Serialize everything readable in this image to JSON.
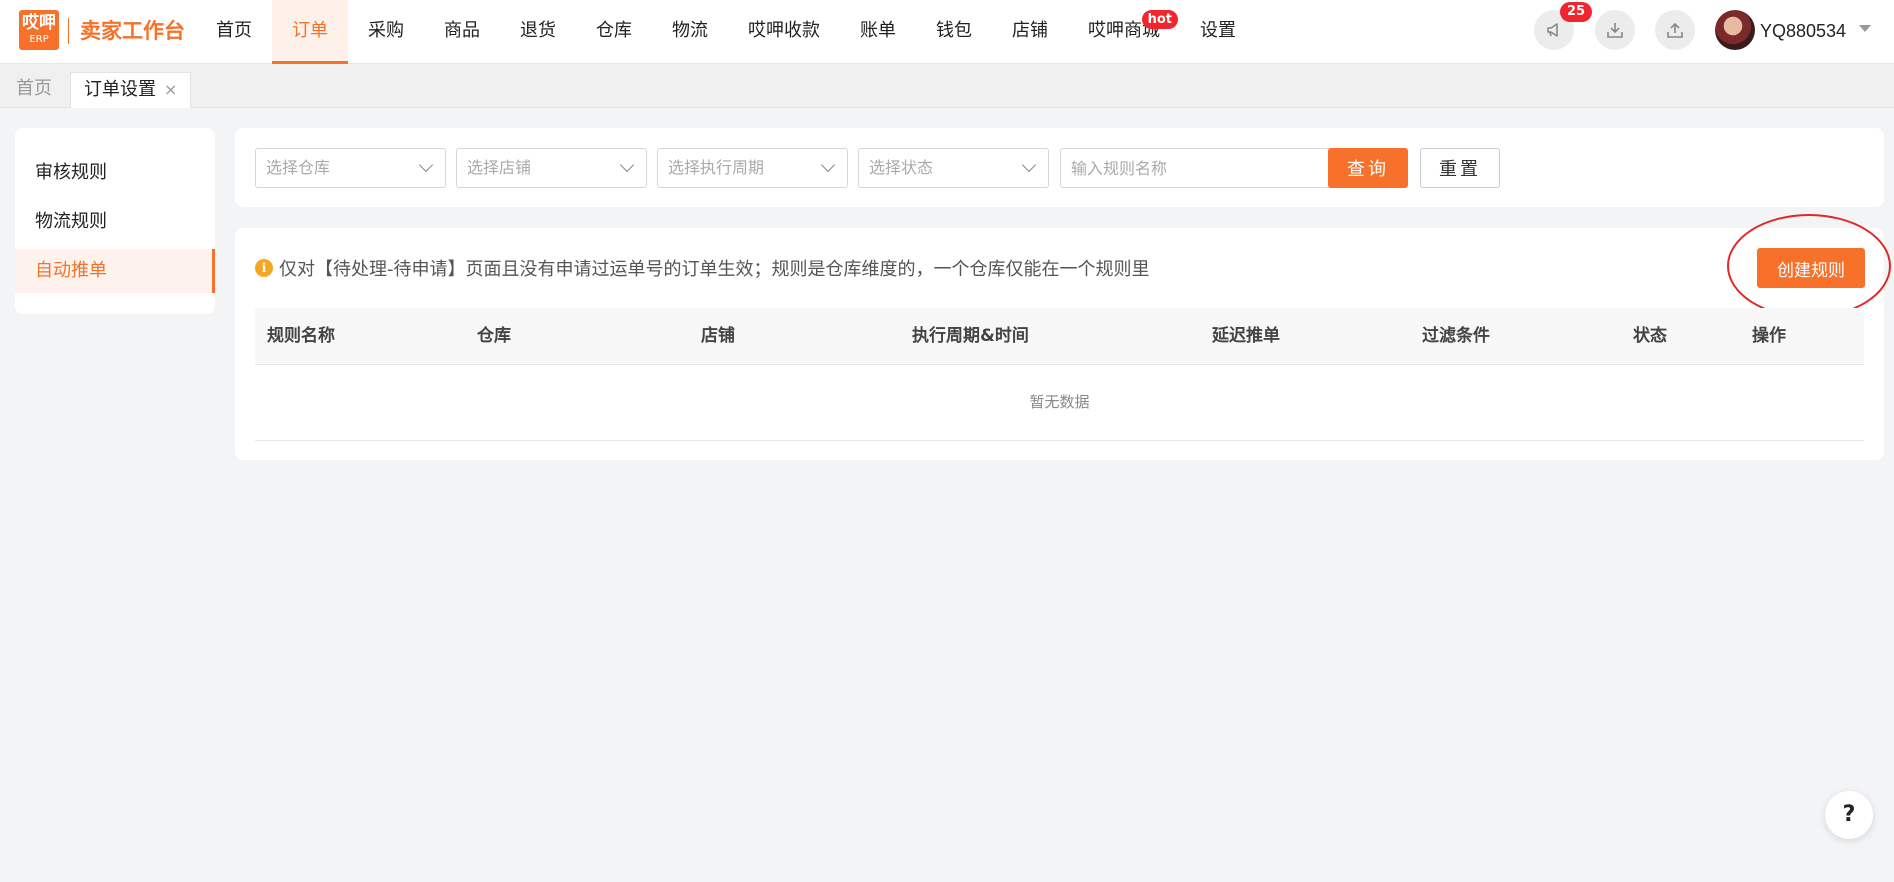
{
  "brand": {
    "logo_top": "哎呷",
    "logo_bottom": "ERP",
    "name": "卖家工作台"
  },
  "nav": [
    {
      "label": "首页"
    },
    {
      "label": "订单"
    },
    {
      "label": "采购"
    },
    {
      "label": "商品"
    },
    {
      "label": "退货"
    },
    {
      "label": "仓库"
    },
    {
      "label": "物流"
    },
    {
      "label": "哎呷收款"
    },
    {
      "label": "账单"
    },
    {
      "label": "钱包"
    },
    {
      "label": "店铺"
    },
    {
      "label": "哎呷商城",
      "badge": "hot"
    },
    {
      "label": "设置"
    }
  ],
  "header": {
    "notification_count": "25",
    "username": "YQ880534"
  },
  "tabs": {
    "home": "首页",
    "current": "订单设置",
    "close": "×"
  },
  "sidebar": {
    "items": [
      {
        "label": "审核规则"
      },
      {
        "label": "物流规则"
      },
      {
        "label": "自动推单"
      }
    ]
  },
  "filters": {
    "warehouse": "选择仓库",
    "store": "选择店铺",
    "period": "选择执行周期",
    "status": "选择状态",
    "rule_name_placeholder": "输入规则名称",
    "query": "查询",
    "reset": "重置"
  },
  "notice": "仅对【待处理-待申请】页面且没有申请过运单号的订单生效；规则是仓库维度的，一个仓库仅能在一个规则里",
  "create_button": "创建规则",
  "table": {
    "columns": [
      "规则名称",
      "仓库",
      "店铺",
      "执行周期&时间",
      "延迟推单",
      "过滤条件",
      "状态",
      "操作"
    ],
    "empty": "暂无数据"
  },
  "help": "?"
}
